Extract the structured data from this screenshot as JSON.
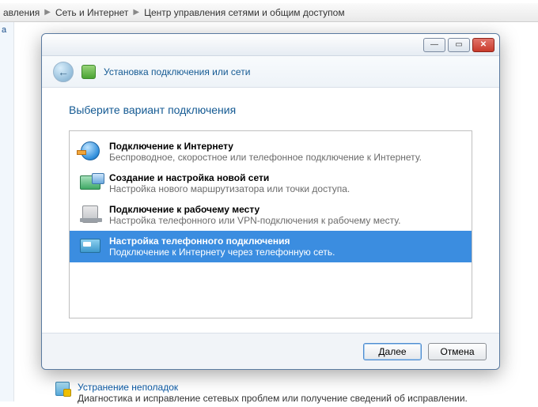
{
  "breadcrumb": {
    "part0": "авления",
    "part1": "Сеть и Интернет",
    "part2": "Центр управления сетями и общим доступом"
  },
  "sidebar": {
    "stub": "а"
  },
  "background_footer": {
    "link": "Устранение неполадок",
    "desc": "Диагностика и исправление сетевых проблем или получение сведений об исправлении."
  },
  "dialog": {
    "window_buttons": {
      "min": "—",
      "max": "▭",
      "close": "✕"
    },
    "banner_title": "Установка подключения или сети",
    "heading": "Выберите вариант подключения",
    "options": [
      {
        "title": "Подключение к Интернету",
        "desc": "Беспроводное, скоростное или телефонное подключение к Интернету."
      },
      {
        "title": "Создание и настройка новой сети",
        "desc": "Настройка нового маршрутизатора или точки доступа."
      },
      {
        "title": "Подключение к рабочему месту",
        "desc": "Настройка телефонного или VPN-подключения к рабочему месту."
      },
      {
        "title": "Настройка телефонного подключения",
        "desc": "Подключение к Интернету через телефонную сеть."
      }
    ],
    "selected_index": 3,
    "buttons": {
      "next": "Далее",
      "cancel": "Отмена"
    }
  }
}
